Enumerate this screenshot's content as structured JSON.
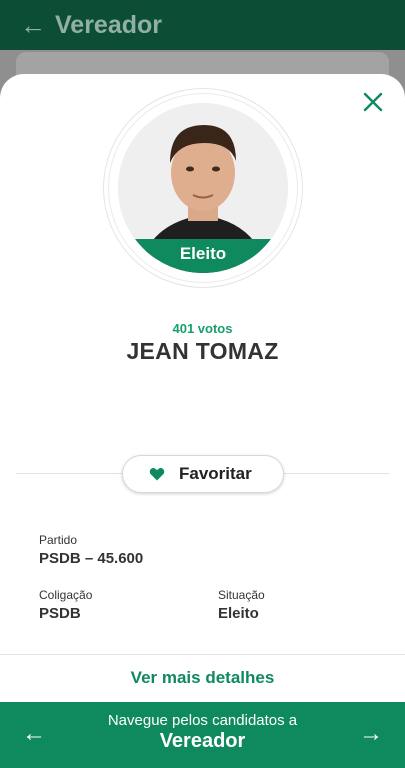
{
  "appbar": {
    "back_icon": "←",
    "title": "Vereador"
  },
  "candidate": {
    "badge": "Eleito",
    "votes": "401 votos",
    "name": "JEAN TOMAZ",
    "favorite_label": "Favoritar",
    "fields": {
      "partido": {
        "label": "Partido",
        "value": "PSDB – 45.600"
      },
      "coligacao": {
        "label": "Coligação",
        "value": "PSDB"
      },
      "situacao": {
        "label": "Situação",
        "value": "Eleito"
      }
    },
    "more_details": "Ver mais detalhes"
  },
  "bottom_nav": {
    "prev_icon": "←",
    "next_icon": "→",
    "subtitle": "Navegue pelos candidatos a",
    "title": "Vereador"
  },
  "colors": {
    "appbar": "#0b4d35",
    "accent": "#0f8a5f",
    "votes": "#17a06d"
  }
}
